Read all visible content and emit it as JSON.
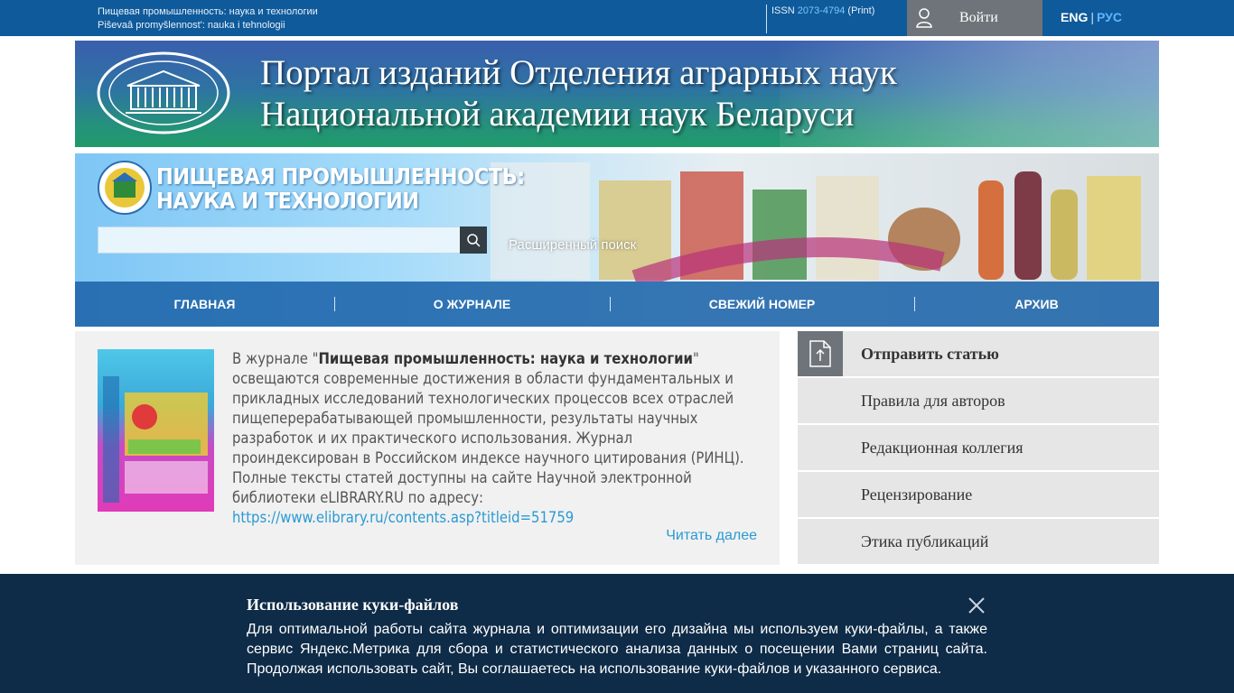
{
  "topbar": {
    "journal_ru": "Пищевая промышленность: наука и технологии",
    "journal_translit": "Piŝevaâ promyšlennost': nauka i tehnologii",
    "issn_label": "ISSN",
    "issn_number": "2073-4794",
    "issn_type": "(Print)",
    "login_label": "Войти",
    "lang_eng": "ENG",
    "lang_sep": "|",
    "lang_rus": "РУС"
  },
  "portal": {
    "title_line1": "Портал изданий Отделения аграрных наук",
    "title_line2": "Национальной академии наук Беларуси"
  },
  "journal": {
    "name_line1": "ПИЩЕВАЯ ПРОМЫШЛЕННОСТЬ:",
    "name_line2": "НАУКА И ТЕХНОЛОГИИ",
    "advanced_search": "Расширенный поиск",
    "search_placeholder": ""
  },
  "nav": {
    "items": [
      {
        "label": "ГЛАВНАЯ"
      },
      {
        "label": "О ЖУРНАЛЕ"
      },
      {
        "label": "СВЕЖИЙ НОМЕР"
      },
      {
        "label": "АРХИВ"
      }
    ]
  },
  "about": {
    "text_before": "В журнале \"",
    "journal_bold": "Пищевая промышленность: наука и технологии",
    "text_after": "\" освещаются современные достижения в области фундаментальных и прикладных исследований технологических процессов всех отраслей пищеперерабатывающей промышленности, результаты научных разработок и их практического использования. Журнал проиндексирован в Российском индексе научного цитирования (РИНЦ). Полные тексты статей доступны на сайте Научной электронной библиотеки eLIBRARY.RU по адресу:",
    "link": "https://www.elibrary.ru/contents.asp?titleid=51759",
    "read_more": "Читать далее"
  },
  "sidebar": {
    "items": [
      {
        "label": "Отправить статью",
        "icon": "upload-document-icon"
      },
      {
        "label": "Правила для авторов"
      },
      {
        "label": "Редакционная коллегия"
      },
      {
        "label": "Рецензирование"
      },
      {
        "label": "Этика публикаций"
      }
    ]
  },
  "cookie": {
    "title": "Использование куки-файлов",
    "text": "Для оптимальной работы сайта журнала и оптимизации его дизайна мы используем куки-файлы, а также сервис Яндекс.Метрика для сбора и статистического анализа данных о посещении Вами страниц сайта. Продолжая использовать сайт, Вы соглашаетесь на использование куки-файлов и указанного сервиса."
  },
  "colors": {
    "topbar": "#0f5a9a",
    "nav": "#1c64aa",
    "link": "#2a9ad3",
    "cookie_bg": "#0e2b47",
    "login_bg": "#6e7479"
  }
}
